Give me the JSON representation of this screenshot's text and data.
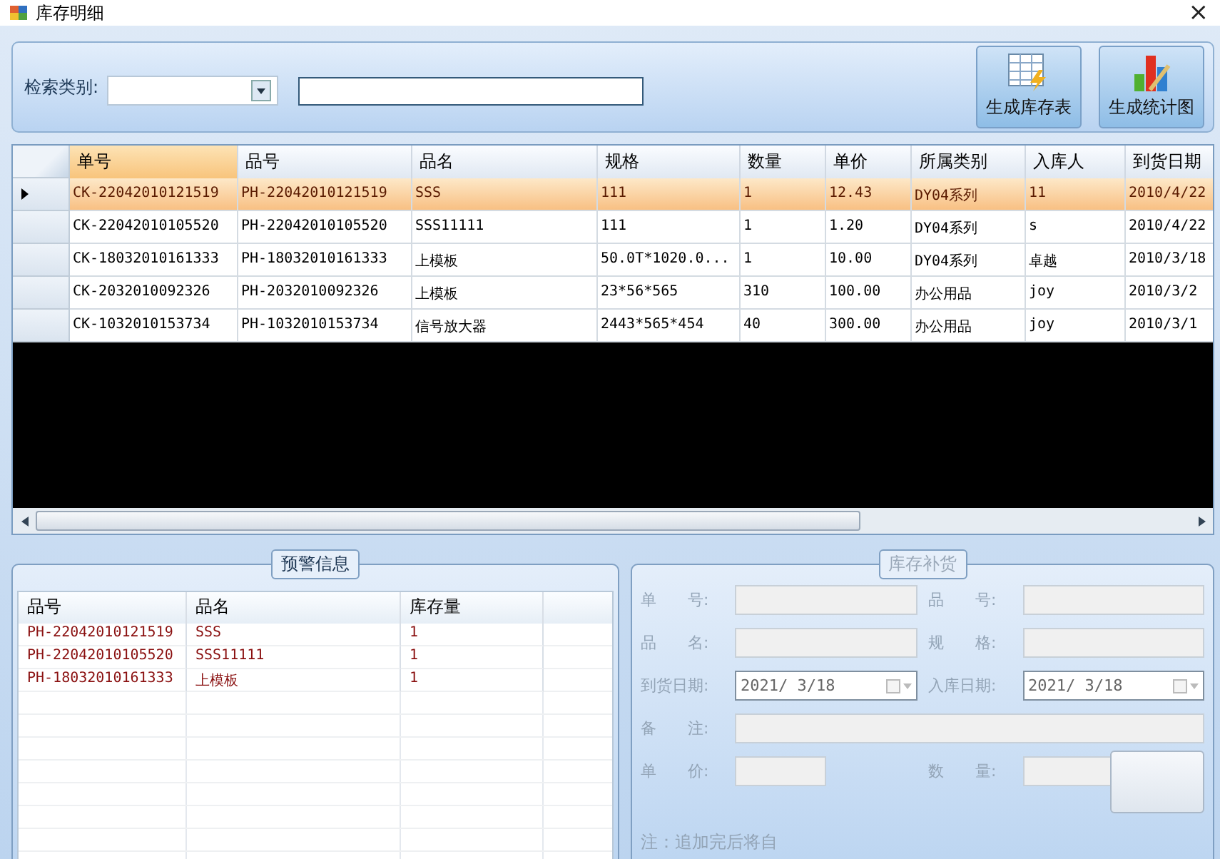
{
  "window": {
    "title": "库存明细",
    "close": "×"
  },
  "search": {
    "label": "检索类别:"
  },
  "toolbar": [
    {
      "kind": "table",
      "label": "生成库存表"
    },
    {
      "kind": "chart",
      "label": "生成统计图"
    }
  ],
  "grid": {
    "columns": [
      "单号",
      "品号",
      "品名",
      "规格",
      "数量",
      "单价",
      "所属类别",
      "入库人",
      "到货日期"
    ],
    "rows": [
      {
        "selected": true,
        "cells": [
          "CK-22042010121519",
          "PH-22042010121519",
          "SSS",
          "111",
          "1",
          "12.43",
          "DY04系列",
          "11",
          "2010/4/22"
        ]
      },
      {
        "selected": false,
        "cells": [
          "CK-22042010105520",
          "PH-22042010105520",
          "SSS11111",
          "111",
          "1",
          "1.20",
          "DY04系列",
          "s",
          "2010/4/22"
        ]
      },
      {
        "selected": false,
        "cells": [
          "CK-18032010161333",
          "PH-18032010161333",
          "上模板",
          "50.0T*1020.0...",
          "1",
          "10.00",
          "DY04系列",
          "卓越",
          "2010/3/18"
        ]
      },
      {
        "selected": false,
        "cells": [
          "CK-2032010092326",
          "PH-2032010092326",
          "上模板",
          "23*56*565",
          "310",
          "100.00",
          "办公用品",
          "joy",
          "2010/3/2"
        ]
      },
      {
        "selected": false,
        "cells": [
          "CK-1032010153734",
          "PH-1032010153734",
          "信号放大器",
          "2443*565*454",
          "40",
          "300.00",
          "办公用品",
          "joy",
          "2010/3/1"
        ]
      }
    ]
  },
  "warning": {
    "title": "预警信息",
    "columns": [
      "品号",
      "品名",
      "库存量"
    ],
    "rows": [
      [
        "PH-22042010121519",
        "SSS",
        "1"
      ],
      [
        "PH-22042010105520",
        "SSS11111",
        "1"
      ],
      [
        "PH-18032010161333",
        "上模板",
        "1"
      ]
    ]
  },
  "restock": {
    "title": "库存补货",
    "disabled": true,
    "fields": [
      {
        "label": "单　　号:",
        "kind": "text"
      },
      {
        "label": "品　　号:",
        "kind": "text"
      },
      {
        "label": "品　　名:",
        "kind": "text"
      },
      {
        "label": "规　　格:",
        "kind": "text"
      },
      {
        "label": "到货日期:",
        "kind": "date",
        "value": "2021/ 3/18"
      },
      {
        "label": "入库日期:",
        "kind": "date",
        "value": "2021/ 3/18"
      },
      {
        "label": "备　　注:",
        "kind": "wide"
      },
      {
        "label": "单　　价:",
        "kind": "short"
      },
      {
        "label": "数　　量:",
        "kind": "short"
      }
    ],
    "note": "注：追加完后将自"
  }
}
